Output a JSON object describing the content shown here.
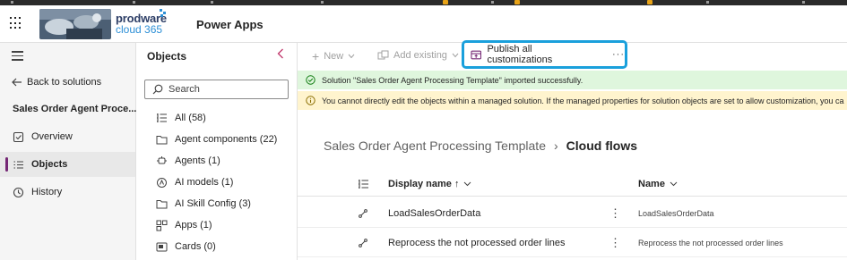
{
  "header": {
    "brand_line1": "prodware",
    "brand_line2": "cloud 365",
    "app_name": "Power Apps"
  },
  "leftnav": {
    "back_label": "Back to solutions",
    "solution_title": "Sales Order Agent Proce...",
    "items": [
      {
        "label": "Overview",
        "icon": "overview-icon"
      },
      {
        "label": "Objects",
        "icon": "objects-icon",
        "active": true
      },
      {
        "label": "History",
        "icon": "history-icon"
      }
    ]
  },
  "objects_panel": {
    "title": "Objects",
    "search_placeholder": "Search",
    "items": [
      {
        "label": "All (58)",
        "icon": "list-icon"
      },
      {
        "label": "Agent components (22)",
        "icon": "folder-icon"
      },
      {
        "label": "Agents (1)",
        "icon": "agent-icon"
      },
      {
        "label": "AI models (1)",
        "icon": "ai-model-icon"
      },
      {
        "label": "AI Skill Config (3)",
        "icon": "folder-icon"
      },
      {
        "label": "Apps (1)",
        "icon": "apps-icon"
      },
      {
        "label": "Cards (0)",
        "icon": "card-icon"
      }
    ]
  },
  "commandbar": {
    "new_label": "New",
    "add_existing_label": "Add existing",
    "publish_label": "Publish all customizations",
    "more_label": "···"
  },
  "messages": {
    "success": "Solution \"Sales Order Agent Processing Template\" imported successfully.",
    "warning": "You cannot directly edit the objects within a managed solution. If the managed properties for solution objects are set to allow customization, you ca"
  },
  "breadcrumb": {
    "parent": "Sales Order Agent Processing Template",
    "separator": "›",
    "current": "Cloud flows"
  },
  "grid": {
    "col_display_name": "Display name ↑",
    "col_name": "Name",
    "rows": [
      {
        "display_name": "LoadSalesOrderData",
        "name": "LoadSalesOrderData"
      },
      {
        "display_name": "Reprocess the not processed order lines",
        "name": "Reprocess the not processed order lines"
      }
    ]
  },
  "colors": {
    "accent": "#742774",
    "highlight": "#1aa0dc",
    "success_bg": "#dff6dd",
    "warning_bg": "#fff4ce"
  }
}
